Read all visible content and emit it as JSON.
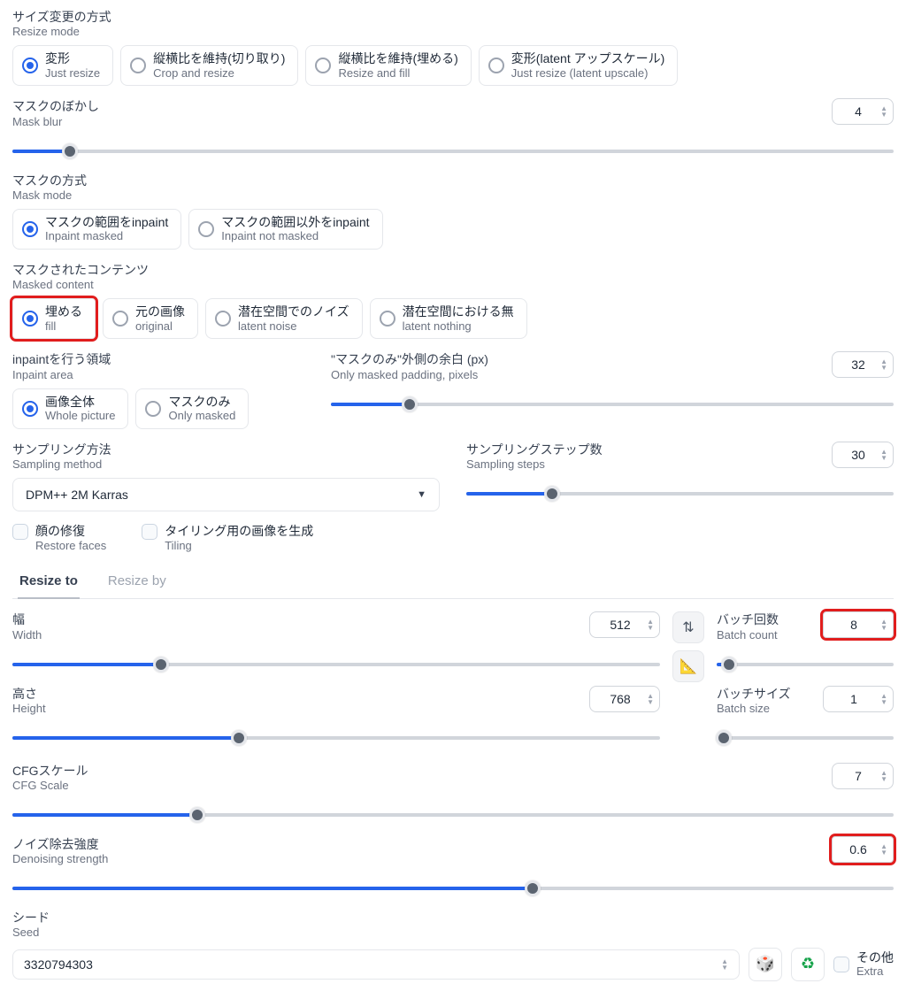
{
  "resize_mode": {
    "label_jp": "サイズ変更の方式",
    "label_en": "Resize mode",
    "options": [
      {
        "jp": "変形",
        "en": "Just resize"
      },
      {
        "jp": "縦横比を維持(切り取り)",
        "en": "Crop and resize"
      },
      {
        "jp": "縦横比を維持(埋める)",
        "en": "Resize and fill"
      },
      {
        "jp": "変形(latent アップスケール)",
        "en": "Just resize (latent upscale)"
      }
    ]
  },
  "mask_blur": {
    "label_jp": "マスクのぼかし",
    "label_en": "Mask blur",
    "value": "4"
  },
  "mask_mode": {
    "label_jp": "マスクの方式",
    "label_en": "Mask mode",
    "options": [
      {
        "jp": "マスクの範囲をinpaint",
        "en": "Inpaint masked"
      },
      {
        "jp": "マスクの範囲以外をinpaint",
        "en": "Inpaint not masked"
      }
    ]
  },
  "masked_content": {
    "label_jp": "マスクされたコンテンツ",
    "label_en": "Masked content",
    "options": [
      {
        "jp": "埋める",
        "en": "fill"
      },
      {
        "jp": "元の画像",
        "en": "original"
      },
      {
        "jp": "潜在空間でのノイズ",
        "en": "latent noise"
      },
      {
        "jp": "潜在空間における無",
        "en": "latent nothing"
      }
    ]
  },
  "inpaint_area": {
    "label_jp": "inpaintを行う領域",
    "label_en": "Inpaint area",
    "options": [
      {
        "jp": "画像全体",
        "en": "Whole picture"
      },
      {
        "jp": "マスクのみ",
        "en": "Only masked"
      }
    ]
  },
  "only_masked_padding": {
    "label_jp": "\"マスクのみ\"外側の余白 (px)",
    "label_en": "Only masked padding, pixels",
    "value": "32"
  },
  "sampling_method": {
    "label_jp": "サンプリング方法",
    "label_en": "Sampling method",
    "value": "DPM++ 2M Karras"
  },
  "sampling_steps": {
    "label_jp": "サンプリングステップ数",
    "label_en": "Sampling steps",
    "value": "30"
  },
  "restore_faces": {
    "jp": "顔の修復",
    "en": "Restore faces"
  },
  "tiling": {
    "jp": "タイリング用の画像を生成",
    "en": "Tiling"
  },
  "tabs": {
    "resize_to": "Resize to",
    "resize_by": "Resize by"
  },
  "width": {
    "label_jp": "幅",
    "label_en": "Width",
    "value": "512"
  },
  "height": {
    "label_jp": "高さ",
    "label_en": "Height",
    "value": "768"
  },
  "batch_count": {
    "label_jp": "バッチ回数",
    "label_en": "Batch count",
    "value": "8"
  },
  "batch_size": {
    "label_jp": "バッチサイズ",
    "label_en": "Batch size",
    "value": "1"
  },
  "cfg": {
    "label_jp": "CFGスケール",
    "label_en": "CFG Scale",
    "value": "7"
  },
  "denoise": {
    "label_jp": "ノイズ除去強度",
    "label_en": "Denoising strength",
    "value": "0.6"
  },
  "seed": {
    "label_jp": "シード",
    "label_en": "Seed",
    "value": "3320794303"
  },
  "extra": {
    "jp": "その他",
    "en": "Extra"
  }
}
